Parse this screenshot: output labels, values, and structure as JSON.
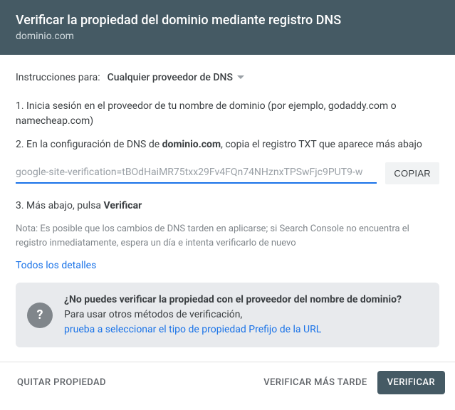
{
  "header": {
    "title": "Verificar la propiedad del dominio mediante registro DNS",
    "domain": "dominio.com"
  },
  "instructions": {
    "label": "Instrucciones para:",
    "provider": "Cualquier proveedor de DNS"
  },
  "steps": {
    "s1": "1. Inicia sesión en el proveedor de tu nombre de dominio (por ejemplo, godaddy.com o namecheap.com)",
    "s2_pre": "2. En la configuración de DNS de ",
    "s2_bold": "dominio.com",
    "s2_post": ", copia el registro TXT que aparece más abajo",
    "s3_pre": "3. Más abajo, pulsa ",
    "s3_bold": "Verificar"
  },
  "txt": {
    "value": "google-site-verification=tBOdHaiMR75txx29Fv4FQn74NHznxTPSwFjc9PUT9-w",
    "copy": "COPIAR"
  },
  "note": "Nota: Es posible que los cambios de DNS tarden en aplicarse; si Search Console no encuentra el registro inmediatamente, espera un día e intenta verificarlo de nuevo",
  "details_link": "Todos los detalles",
  "info": {
    "title": "¿No puedes verificar la propiedad con el proveedor del nombre de dominio?",
    "sub": "Para usar otros métodos de verificación,",
    "link": "prueba a seleccionar el tipo de propiedad Prefijo de la URL",
    "icon": "?"
  },
  "footer": {
    "remove": "QUITAR PROPIEDAD",
    "later": "VERIFICAR MÁS TARDE",
    "verify": "VERIFICAR"
  }
}
